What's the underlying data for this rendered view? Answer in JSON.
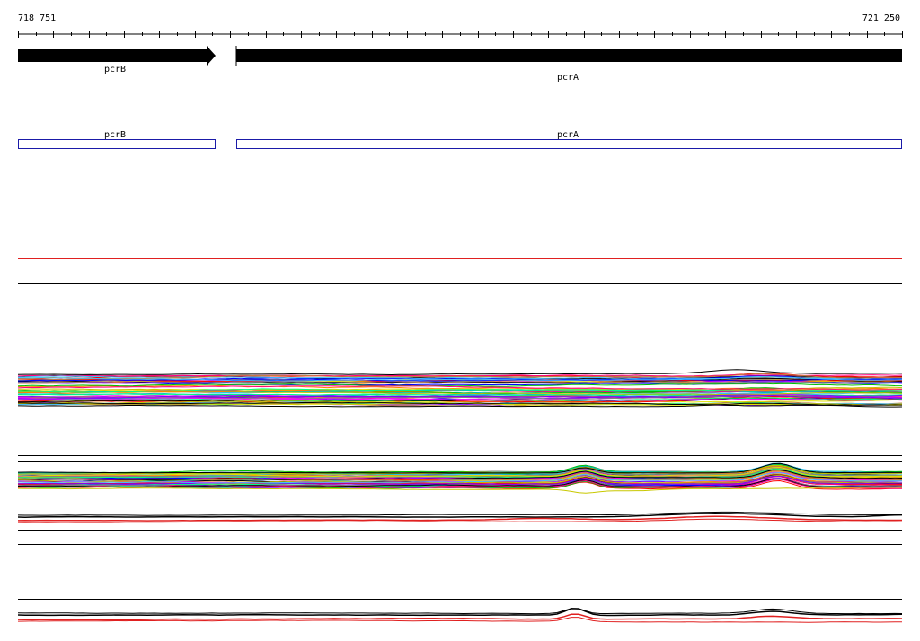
{
  "ruler": {
    "start_label": "718 751",
    "end_label": "721 250"
  },
  "genes": [
    {
      "id": "pcrB",
      "strand": "+",
      "label": "pcrB"
    },
    {
      "id": "pcrA",
      "strand": "+",
      "label": "pcrA"
    }
  ],
  "gene_boxes": [
    {
      "id": "pcrB",
      "label": "pcrB"
    },
    {
      "id": "pcrA",
      "label": "pcrA"
    }
  ],
  "colors": {
    "gene_fill": "#000000",
    "box_stroke": "#1a1aa8",
    "red_line": "#e02020",
    "track_line": "#000000",
    "palette": [
      "#ff0000",
      "#00c000",
      "#0000ff",
      "#ff00ff",
      "#00c0c0",
      "#c0c000",
      "#ff8000",
      "#8000ff",
      "#00ff80",
      "#ff0080",
      "#808080",
      "#c08040",
      "#40c0ff",
      "#e0e000",
      "#000000"
    ]
  }
}
